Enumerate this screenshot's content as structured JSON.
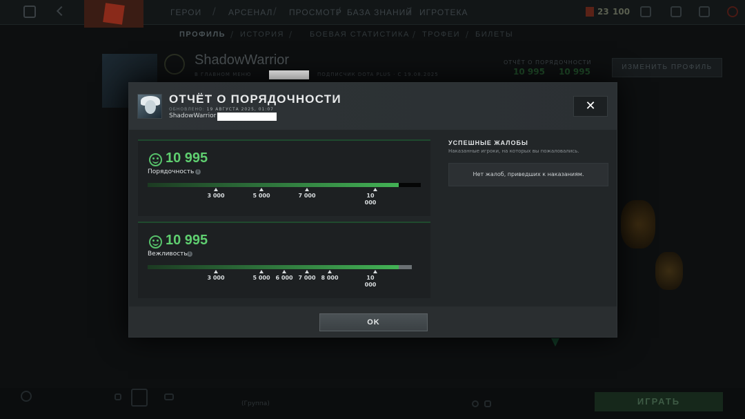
{
  "background": {
    "topnav": [
      "ГЕРОИ",
      "АРСЕНАЛ",
      "ПРОСМОТР",
      "БАЗА ЗНАНИЙ",
      "ИГРОТЕКА"
    ],
    "shards": "23",
    "level": "100",
    "subnav": [
      "ПРОФИЛЬ",
      "ИСТОРИЯ",
      "БОЕВАЯ СТАТИСТИКА",
      "ТРОФЕИ",
      "БИЛЕТЫ"
    ],
    "profile_name": "ShadowWarrior",
    "profile_menu": "В ГЛАВНОМ МЕНЮ",
    "profile_plus": "ПОДПИСЧИК DOTA PLUS · С 19.08.2025",
    "conduct_title": "ОТЧЁТ О ПОРЯДОЧНОСТИ",
    "conduct_a": "10 995",
    "conduct_b": "10 995",
    "edit_profile": "ИЗМЕНИТЬ ПРОФИЛЬ",
    "play": "ИГРАТЬ",
    "chat": "(Группа)"
  },
  "modal": {
    "title": "ОТЧЁТ О ПОРЯДОЧНОСТИ",
    "updated_label": "ОБНОВЛЕНО:",
    "updated_value": "19 АВГУСТА 2025, 01:07",
    "username": "ShadowWarrior",
    "close_label": "✕",
    "conduct": {
      "value": "10 995",
      "label": "Порядочность",
      "fill": 0.92,
      "ticks": [
        "3 000",
        "5 000",
        "7 000",
        "10 000"
      ]
    },
    "politeness": {
      "value": "10 995",
      "label": "Вежливость",
      "fill": 0.95,
      "ticks": [
        "3 000",
        "5 000",
        "6 000",
        "7 000",
        "8 000",
        "10 000"
      ]
    },
    "reports": {
      "title": "УСПЕШНЫЕ ЖАЛОБЫ",
      "subtitle": "Наказанные игроки, на которых вы пожаловались.",
      "empty": "Нет жалоб, приведших к наказаниям."
    },
    "ok_label": "OK"
  },
  "colors": {
    "accent_green": "#5fcf70",
    "bar_green": "#43b255",
    "modal_bg": "#25292b"
  }
}
